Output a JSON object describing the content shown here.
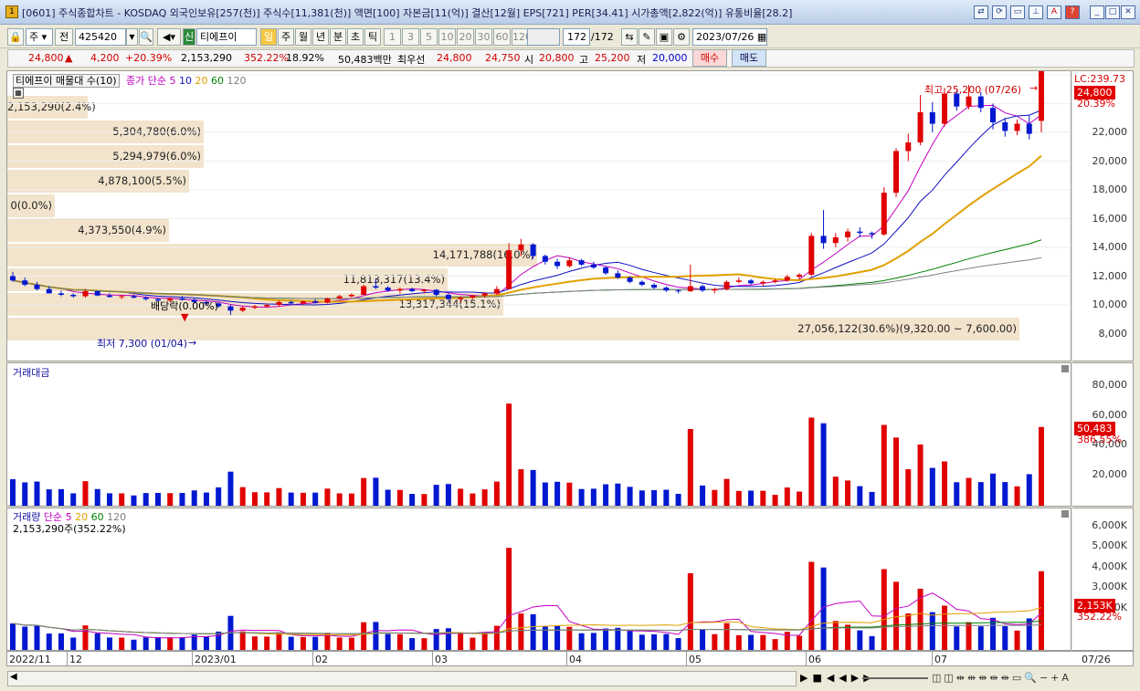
{
  "window": {
    "title": "[0601] 주식종합차트 - KOSDAQ 외국인보유[257(천)] 주식수[11,381(천)] 액면[100] 자본금[11(억)] 결산[12월] EPS[721] PER[34.41] 시가총액[2,822(억)] 유통비율[28.2]",
    "icon": "1"
  },
  "toolbar": {
    "type": "주",
    "prefix": "전",
    "code": "425420",
    "name": "티에프이",
    "period_tabs": [
      "일",
      "주",
      "월",
      "년",
      "분",
      "초",
      "틱"
    ],
    "intervals": [
      "1",
      "3",
      "5",
      "10",
      "20",
      "30",
      "60",
      "120"
    ],
    "count": "172",
    "count_total": "/172",
    "date": "2023/07/26",
    "sin": "신"
  },
  "quote": {
    "price": "24,800",
    "arrow": "▲",
    "change": "4,200",
    "change_pct": "+20.39%",
    "volume": "2,153,290",
    "vol_ratio": "352.22%",
    "turnover": "18.92%",
    "amount": "50,483백만",
    "best_label": "최우선",
    "best_ask": "24,800",
    "best_bid": "24,750",
    "open_label": "시",
    "open": "20,800",
    "high_label": "고",
    "high": "25,200",
    "low_label": "저",
    "low": "20,000",
    "buy": "매수",
    "sell": "매도"
  },
  "price_panel": {
    "legend_title": "티에프이 매물대 수(10)",
    "ma_label": "종가 단순",
    "ma_periods": [
      "5",
      "10",
      "20",
      "60",
      "120"
    ],
    "lc_label": "LC:239.73",
    "last_price": "24,800",
    "last_pct": "20.39%",
    "high_note": "최고 25,200 (07/26)",
    "low_note": "최저 7,300 (01/04)",
    "dividend_note": "배당락(0.00%)",
    "volume_bands": [
      {
        "label": "2,153,290(2.4%)"
      },
      {
        "label": "5,304,780(6.0%)"
      },
      {
        "label": "5,294,979(6.0%)"
      },
      {
        "label": "4,878,100(5.5%)"
      },
      {
        "label": "0(0.0%)"
      },
      {
        "label": "4,373,550(4.9%)"
      },
      {
        "label": "14,171,788(16.0%)"
      },
      {
        "label": "11,813,317(13.4%)"
      },
      {
        "label": "13,317,344(15.1%)"
      },
      {
        "label": "27,056,122(30.6%)(9,320.00 ~ 7,600.00)"
      }
    ],
    "y_ticks": [
      "22,000",
      "20,000",
      "18,000",
      "16,000",
      "14,000",
      "12,000",
      "10,000",
      "8,000"
    ]
  },
  "amount_panel": {
    "title": "거래대금",
    "y_ticks": [
      "80,000",
      "60,000",
      "40,000",
      "20,000"
    ],
    "last_value": "50,483",
    "last_pct": "386.55%"
  },
  "volume_panel": {
    "title": "거래량",
    "ma_label": "단순",
    "ma_periods": [
      "5",
      "20",
      "60",
      "120"
    ],
    "sub": "2,153,290주(352.22%)",
    "y_ticks": [
      "6,000K",
      "5,000K",
      "4,000K",
      "3,000K",
      "1,000K"
    ],
    "last_value": "2,153K",
    "last_pct": "352.22%"
  },
  "x_axis": {
    "labels": [
      "2022/11",
      "12",
      "2023/01",
      "02",
      "03",
      "04",
      "05",
      "06",
      "07"
    ],
    "cursor_date": "07/26"
  },
  "colors": {
    "up": "#e00000",
    "down": "#0018d0",
    "ma5": "#c000c0",
    "ma10": "#1010c0",
    "ma20": "#e0a000",
    "ma60": "#008000",
    "ma120": "#808080",
    "band": "#f2e3cc"
  },
  "chart_data": {
    "type": "candlestick",
    "series": [
      {
        "name": "price",
        "values": [
          [
            10000,
            10300,
            9600,
            9700
          ],
          [
            9700,
            9900,
            9300,
            9400
          ],
          [
            9400,
            9600,
            9000,
            9100
          ],
          [
            9100,
            9300,
            8900,
            8800
          ],
          [
            8800,
            9000,
            8600,
            8700
          ],
          [
            8700,
            8800,
            8500,
            8600
          ],
          [
            8600,
            9100,
            8500,
            8950
          ],
          [
            8950,
            9000,
            8600,
            8650
          ],
          [
            8650,
            8800,
            8500,
            8550
          ],
          [
            8550,
            8700,
            8400,
            8600
          ],
          [
            8600,
            8700,
            8450,
            8500
          ],
          [
            8500,
            8600,
            8300,
            8400
          ],
          [
            8400,
            8500,
            8200,
            8300
          ],
          [
            8300,
            8500,
            8200,
            8450
          ],
          [
            8450,
            8600,
            8300,
            8350
          ],
          [
            8350,
            8450,
            8100,
            8200
          ],
          [
            8200,
            8300,
            8000,
            8100
          ],
          [
            8100,
            8200,
            7800,
            7900
          ],
          [
            7900,
            8000,
            7300,
            7600
          ],
          [
            7600,
            7900,
            7500,
            7800
          ],
          [
            7800,
            8000,
            7700,
            7900
          ],
          [
            7900,
            8100,
            7800,
            8000
          ],
          [
            8000,
            8300,
            7900,
            8200
          ],
          [
            8200,
            8300,
            8000,
            8100
          ],
          [
            8100,
            8300,
            8000,
            8250
          ],
          [
            8250,
            8400,
            8100,
            8150
          ],
          [
            8150,
            8500,
            8100,
            8450
          ],
          [
            8450,
            8700,
            8400,
            8600
          ],
          [
            8600,
            8800,
            8500,
            8700
          ],
          [
            8700,
            9400,
            8700,
            9300
          ],
          [
            9300,
            9800,
            9100,
            9200
          ],
          [
            9200,
            9300,
            8900,
            9000
          ],
          [
            9000,
            9200,
            8800,
            9100
          ],
          [
            9100,
            9200,
            8900,
            8950
          ],
          [
            8950,
            9100,
            8800,
            9050
          ],
          [
            9050,
            9100,
            8600,
            8700
          ],
          [
            8700,
            8800,
            8300,
            8400
          ],
          [
            8400,
            8600,
            8200,
            8500
          ],
          [
            8500,
            8700,
            8400,
            8650
          ],
          [
            8650,
            8900,
            8500,
            8800
          ],
          [
            8800,
            9300,
            8700,
            9100
          ],
          [
            9100,
            12300,
            9100,
            11800
          ],
          [
            11800,
            12600,
            11400,
            12200
          ],
          [
            12200,
            12300,
            11200,
            11400
          ],
          [
            11400,
            11500,
            10800,
            11000
          ],
          [
            11000,
            11200,
            10500,
            10700
          ],
          [
            10700,
            11300,
            10600,
            11100
          ],
          [
            11100,
            11200,
            10700,
            10800
          ],
          [
            10800,
            11000,
            10500,
            10600
          ],
          [
            10600,
            10700,
            10100,
            10200
          ],
          [
            10200,
            10400,
            9800,
            9900
          ],
          [
            9900,
            10000,
            9500,
            9600
          ],
          [
            9600,
            9700,
            9300,
            9400
          ],
          [
            9400,
            9500,
            9100,
            9200
          ],
          [
            9200,
            9300,
            8900,
            9000
          ],
          [
            9000,
            9100,
            8800,
            8950
          ],
          [
            8950,
            10800,
            8900,
            9300
          ],
          [
            9300,
            9400,
            8900,
            9000
          ],
          [
            9000,
            9200,
            8800,
            9100
          ],
          [
            9100,
            9700,
            9000,
            9600
          ],
          [
            9600,
            9900,
            9500,
            9700
          ],
          [
            9700,
            9800,
            9400,
            9500
          ],
          [
            9500,
            9700,
            9300,
            9600
          ],
          [
            9600,
            9800,
            9500,
            9700
          ],
          [
            9700,
            10100,
            9600,
            9950
          ],
          [
            9950,
            10200,
            9800,
            10100
          ],
          [
            10100,
            13000,
            10000,
            12800
          ],
          [
            12800,
            14600,
            11900,
            12300
          ],
          [
            12300,
            13000,
            12000,
            12700
          ],
          [
            12700,
            13300,
            12400,
            13100
          ],
          [
            13100,
            13400,
            12700,
            13000
          ],
          [
            13000,
            13100,
            12600,
            12900
          ],
          [
            12900,
            16200,
            12800,
            15800
          ],
          [
            15800,
            18900,
            15500,
            18700
          ],
          [
            18700,
            19900,
            18000,
            19300
          ],
          [
            19300,
            22600,
            19100,
            21400
          ],
          [
            21400,
            22100,
            20000,
            20600
          ],
          [
            20600,
            23100,
            20400,
            22700
          ],
          [
            22700,
            22900,
            21500,
            21800
          ],
          [
            21800,
            23300,
            21600,
            22500
          ],
          [
            22500,
            22800,
            21400,
            21700
          ],
          [
            21700,
            22000,
            20200,
            20700
          ],
          [
            20700,
            21000,
            19700,
            20100
          ],
          [
            20100,
            20900,
            19800,
            20600
          ],
          [
            20600,
            21200,
            19500,
            19900
          ],
          [
            20800,
            25200,
            20000,
            24800
          ]
        ]
      }
    ]
  }
}
